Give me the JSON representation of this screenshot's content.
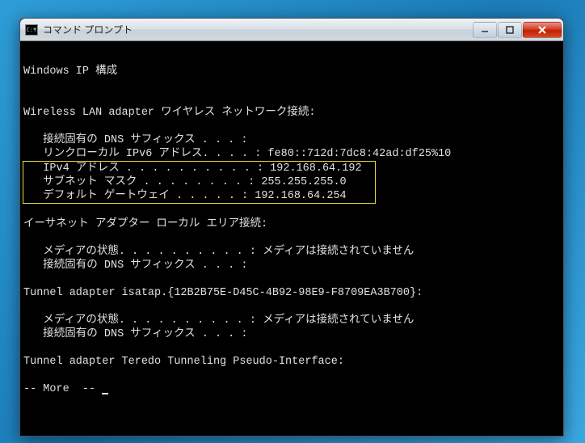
{
  "window": {
    "icon_label": "C:¥",
    "title": "コマンド プロンプト"
  },
  "terminal": {
    "line_blank": "",
    "ipconfig_header": "Windows IP 構成",
    "wlan_header": "Wireless LAN adapter ワイヤレス ネットワーク接続:",
    "wlan_dns": "   接続固有の DNS サフィックス . . . :",
    "wlan_ipv6": "   リンクローカル IPv6 アドレス. . . . : fe80::712d:7dc8:42ad:df25%10",
    "wlan_ipv4": "   IPv4 アドレス . . . . . . . . . . : 192.168.64.192  ",
    "wlan_subnet": "   サブネット マスク . . . . . . . . : 255.255.255.0   ",
    "wlan_gateway": "   デフォルト ゲートウェイ . . . . . : 192.168.64.254  ",
    "eth_header": "イーサネット アダプター ローカル エリア接続:",
    "eth_media": "   メディアの状態. . . . . . . . . . : メディアは接続されていません",
    "eth_dns": "   接続固有の DNS サフィックス . . . :",
    "isatap_header": "Tunnel adapter isatap.{12B2B75E-D45C-4B92-98E9-F8709EA3B700}:",
    "isatap_media": "   メディアの状態. . . . . . . . . . : メディアは接続されていません",
    "isatap_dns": "   接続固有の DNS サフィックス . . . :",
    "teredo_header": "Tunnel adapter Teredo Tunneling Pseudo-Interface:",
    "more_prompt": "-- More  -- "
  }
}
